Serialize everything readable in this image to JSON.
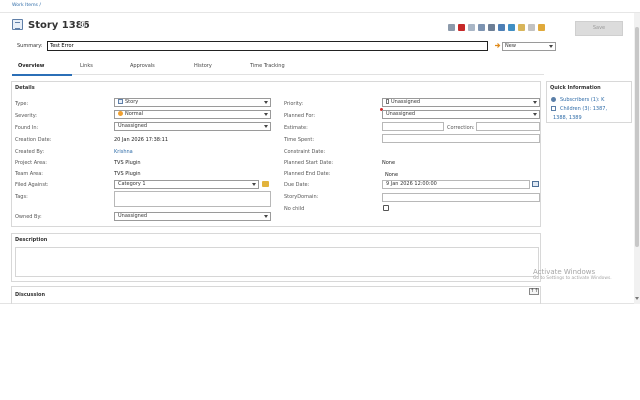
{
  "breadcrumb": "Work Items /",
  "title": "Story 1386",
  "toolbar": {
    "save_label": "Save",
    "icons": [
      "print-icon",
      "delete-icon",
      "copy-icon",
      "duplicate-icon",
      "link-icon",
      "relationships-icon",
      "share-icon",
      "attach-icon",
      "trash-icon",
      "pin-icon"
    ]
  },
  "summary": {
    "label": "Summary:",
    "value": "Test Error"
  },
  "state": {
    "value": "New"
  },
  "tabs": [
    {
      "label": "Overview"
    },
    {
      "label": "Links"
    },
    {
      "label": "Approvals"
    },
    {
      "label": "History"
    },
    {
      "label": "Time Tracking"
    }
  ],
  "details": {
    "title": "Details",
    "left": {
      "type": {
        "label": "Type:",
        "value": "Story"
      },
      "severity": {
        "label": "Severity:",
        "value": "Normal"
      },
      "found_in": {
        "label": "Found In:",
        "value": "Unassigned"
      },
      "creation_date": {
        "label": "Creation Date:",
        "value": "20 Jan 2026 17:38:11"
      },
      "created_by": {
        "label": "Created By:",
        "value": "Krishna"
      },
      "project_area": {
        "label": "Project Area:",
        "value": "TVS Plugin"
      },
      "team_area": {
        "label": "Team Area:",
        "value": "TVS Plugin"
      },
      "filed_against": {
        "label": "Filed Against:",
        "value": "Category 1"
      },
      "tags": {
        "label": "Tags:",
        "value": ""
      },
      "owned_by": {
        "label": "Owned By:",
        "value": "Unassigned"
      }
    },
    "right": {
      "priority": {
        "label": "Priority:",
        "value": "Unassigned"
      },
      "planned_for": {
        "label": "Planned For:",
        "value": "Unassigned"
      },
      "estimate": {
        "label": "Estimate:",
        "value": ""
      },
      "correction": {
        "label": "Correction:",
        "value": ""
      },
      "time_spent": {
        "label": "Time Spent:",
        "value": ""
      },
      "constraint_date": {
        "label": "Constraint Date:",
        "value": ""
      },
      "planned_start_date": {
        "label": "Planned Start Date:",
        "value": "None"
      },
      "planned_end_date": {
        "label": "Planned End Date:",
        "value": "None"
      },
      "due_date": {
        "label": "Due Date:",
        "value": "9 Jan 2026 12:00:00"
      },
      "story_domain": {
        "label": "StoryDomain:",
        "value": ""
      },
      "no_child": {
        "label": "No child",
        "checked": false
      }
    }
  },
  "quick_info": {
    "title": "Quick Information",
    "subscribers": "Subscribers (1): K",
    "children_line1": "Children (3): 1387,",
    "children_line2": "1388, 1389"
  },
  "description": {
    "title": "Description"
  },
  "discussion": {
    "title": "Discussion",
    "button": "↑↑"
  },
  "watermark": {
    "title": "Activate Windows",
    "subtitle": "Go to Settings to activate Windows."
  },
  "colors": {
    "accent": "#2b6fb7",
    "delete": "#c62828",
    "severity": "#f0a030"
  }
}
